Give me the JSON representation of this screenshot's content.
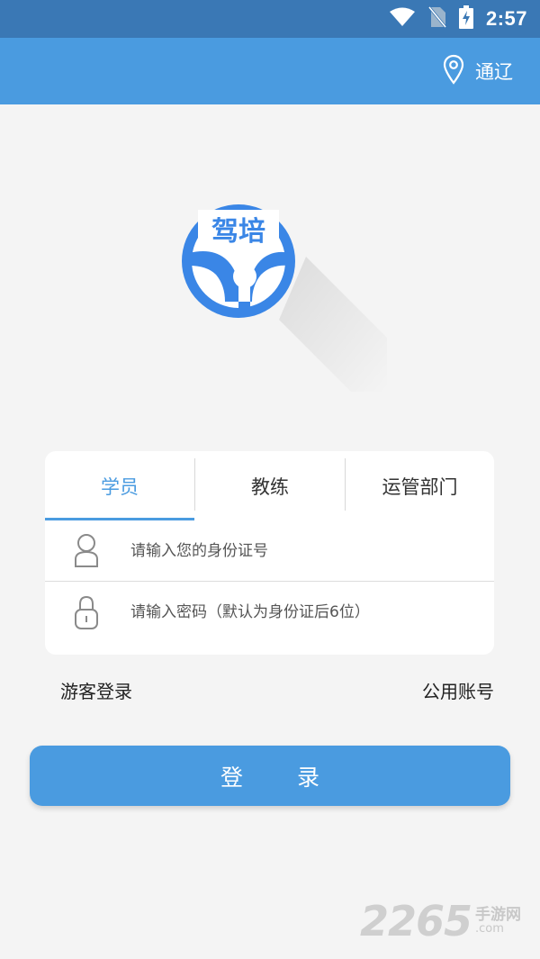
{
  "status_bar": {
    "time": "2:57",
    "icons": [
      "wifi-icon",
      "no-sim-icon",
      "battery-charging-icon"
    ]
  },
  "header": {
    "location_icon": "map-pin-icon",
    "location_label": "通辽"
  },
  "logo": {
    "text": "驾培",
    "color": "#3a86e6"
  },
  "login": {
    "tabs": [
      {
        "label": "学员",
        "active": true
      },
      {
        "label": "教练",
        "active": false
      },
      {
        "label": "运管部门",
        "active": false
      }
    ],
    "id_field": {
      "icon": "user-icon",
      "placeholder": "请输入您的身份证号",
      "value": ""
    },
    "password_field": {
      "icon": "lock-icon",
      "placeholder": "请输入密码（默认为身份证后6位）",
      "value": ""
    },
    "guest_login_label": "游客登录",
    "public_account_label": "公用账号",
    "submit_label": "登录"
  },
  "watermark": {
    "number": "2265",
    "brand": "手游网",
    "domain": ".com"
  },
  "colors": {
    "status_bar": "#3a78b5",
    "header": "#4a9be0",
    "accent": "#4a9be0",
    "background": "#f4f4f4"
  }
}
